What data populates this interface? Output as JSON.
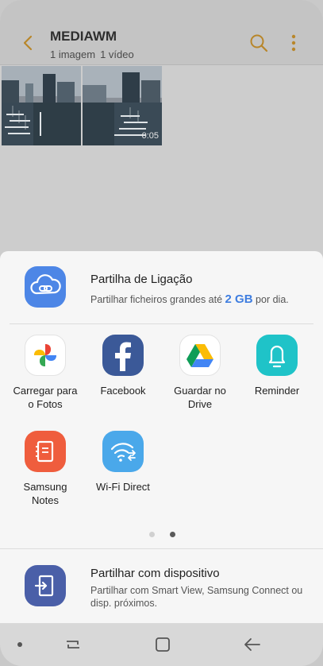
{
  "header": {
    "title": "MEDIAWM",
    "image_count": "1 imagem",
    "video_count": "1 vídeo",
    "back_icon": "chevron-left-icon",
    "search_icon": "search-icon",
    "more_icon": "more-vertical-icon",
    "accent": "#e0a030"
  },
  "gallery": {
    "video_duration": "0:05"
  },
  "link_share": {
    "title": "Partilha de Ligação",
    "desc_prefix": "Partilhar ficheiros grandes até",
    "desc_size": "2 GB",
    "desc_suffix": "por dia."
  },
  "apps": [
    {
      "label_line1": "Carregar para",
      "label_line2": "o Fotos",
      "icon": "google-photos-icon"
    },
    {
      "label_line1": "Facebook",
      "label_line2": "",
      "icon": "facebook-icon"
    },
    {
      "label_line1": "Guardar no",
      "label_line2": "Drive",
      "icon": "google-drive-icon"
    },
    {
      "label_line1": "Reminder",
      "label_line2": "",
      "icon": "reminder-bell-icon"
    },
    {
      "label_line1": "Samsung",
      "label_line2": "Notes",
      "icon": "samsung-notes-icon"
    },
    {
      "label_line1": "Wi-Fi Direct",
      "label_line2": "",
      "icon": "wifi-direct-icon"
    }
  ],
  "pager": {
    "pages": 2,
    "current_page": 2
  },
  "device_share": {
    "title": "Partilhar com dispositivo",
    "desc": "Partilhar com Smart View, Samsung Connect ou disp. próximos."
  },
  "nav": {
    "recent_icon": "recent-apps-icon",
    "home_icon": "home-icon",
    "back_icon": "back-arrow-icon"
  }
}
